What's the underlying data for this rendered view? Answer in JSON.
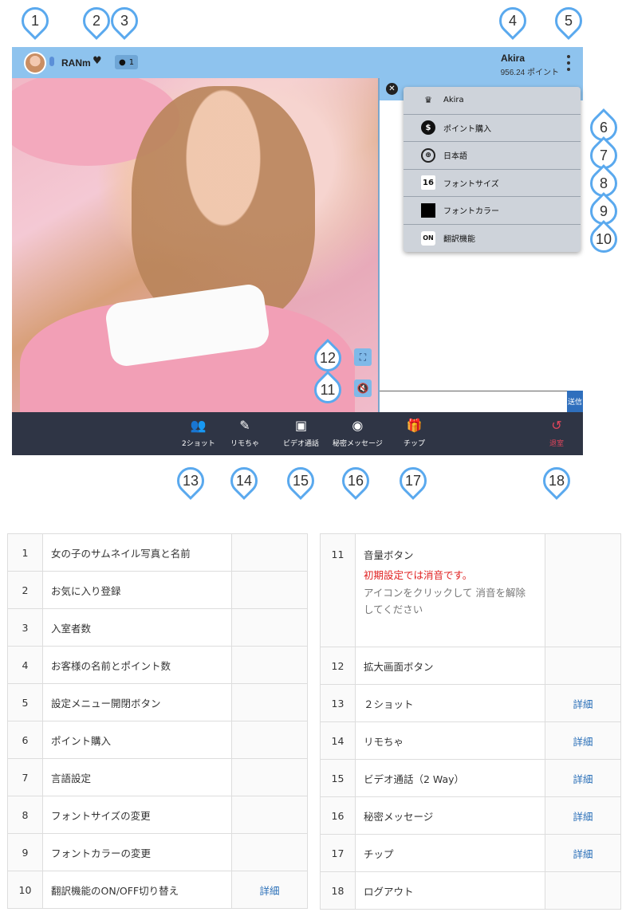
{
  "topbar": {
    "host_name": "RANm",
    "heart_icon": "heart-icon",
    "viewer_count": "1",
    "user_name": "Akira",
    "user_points": "956.24 ポイント"
  },
  "video": {
    "fullscreen_icon": "fullscreen-icon",
    "mute_icon": "speaker-muted-icon"
  },
  "chat": {
    "send_label": "送信"
  },
  "menu": {
    "items": [
      {
        "label": "Akira",
        "icon": "crown-icon"
      },
      {
        "label": "ポイント購入",
        "icon": "dollar-icon"
      },
      {
        "label": "日本語",
        "icon": "globe-icon"
      },
      {
        "label": "フォントサイズ",
        "icon": "font-size-icon",
        "badge": "16"
      },
      {
        "label": "フォントカラー",
        "icon": "color-swatch-icon",
        "color": "#000000"
      },
      {
        "label": "翻訳機能",
        "icon": "on-toggle-icon",
        "badge": "ON"
      }
    ]
  },
  "bottombar": {
    "items": [
      {
        "label": "2ショット",
        "icon": "two-people-icon"
      },
      {
        "label": "リモちゃ",
        "icon": "remote-toy-icon"
      },
      {
        "label": "ビデオ通話",
        "icon": "video-camera-icon"
      },
      {
        "label": "秘密メッセージ",
        "icon": "secret-message-icon"
      },
      {
        "label": "チップ",
        "icon": "gift-icon"
      },
      {
        "label": "退室",
        "icon": "logout-icon",
        "color": "#e0455b"
      }
    ]
  },
  "pins": [
    "1",
    "2",
    "3",
    "4",
    "5",
    "6",
    "7",
    "8",
    "9",
    "10",
    "11",
    "12",
    "13",
    "14",
    "15",
    "16",
    "17",
    "18"
  ],
  "table_left": [
    {
      "num": "1",
      "desc": "女の子のサムネイル写真と名前",
      "link": ""
    },
    {
      "num": "2",
      "desc": "お気に入り登録",
      "link": ""
    },
    {
      "num": "3",
      "desc": "入室者数",
      "link": ""
    },
    {
      "num": "4",
      "desc": "お客様の名前とポイント数",
      "link": ""
    },
    {
      "num": "5",
      "desc": "設定メニュー開閉ボタン",
      "link": ""
    },
    {
      "num": "6",
      "desc": "ポイント購入",
      "link": ""
    },
    {
      "num": "7",
      "desc": "言語設定",
      "link": ""
    },
    {
      "num": "8",
      "desc": "フォントサイズの変更",
      "link": ""
    },
    {
      "num": "9",
      "desc": "フォントカラーの変更",
      "link": ""
    },
    {
      "num": "10",
      "desc": "翻訳機能のON/OFF切り替え",
      "link": "詳細"
    }
  ],
  "table_right": [
    {
      "num": "11",
      "desc": "音量ボタン",
      "note_red": "初期設定では消音です。",
      "note_gray": "アイコンをクリックして 消音を解除してください",
      "link": ""
    },
    {
      "num": "12",
      "desc": "拡大画面ボタン",
      "link": ""
    },
    {
      "num": "13",
      "desc": "２ショット",
      "link": "詳細"
    },
    {
      "num": "14",
      "desc": "リモちゃ",
      "link": "詳細"
    },
    {
      "num": "15",
      "desc": "ビデオ通話（2 Way）",
      "link": "詳細"
    },
    {
      "num": "16",
      "desc": "秘密メッセージ",
      "link": "詳細"
    },
    {
      "num": "17",
      "desc": "チップ",
      "link": "詳細"
    },
    {
      "num": "18",
      "desc": "ログアウト",
      "link": ""
    }
  ]
}
